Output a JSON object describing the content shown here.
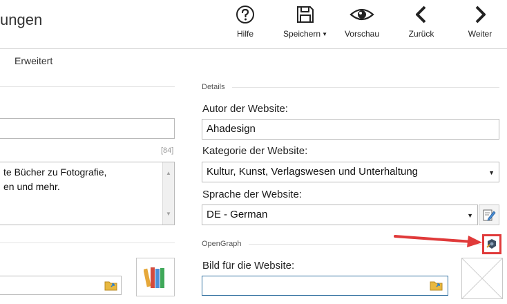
{
  "header": {
    "title": "ungen",
    "tools": [
      {
        "label": "Hilfe",
        "icon": "help-icon"
      },
      {
        "label": "Speichern",
        "icon": "save-icon",
        "dropdown": true
      },
      {
        "label": "Vorschau",
        "icon": "eye-icon"
      },
      {
        "label": "Zurück",
        "icon": "chevron-left-icon"
      },
      {
        "label": "Weiter",
        "icon": "chevron-right-icon"
      }
    ]
  },
  "tabs": {
    "erweitert": "Erweitert"
  },
  "left": {
    "counter": "[84]",
    "description_line1": "te Bücher zu Fotografie,",
    "description_line2": "en und mehr."
  },
  "details": {
    "section_label": "Details",
    "author_label": "Autor der Website:",
    "author_value": "Ahadesign",
    "category_label": "Kategorie der Website:",
    "category_value": "Kultur, Kunst, Verlagswesen und Unterhaltung",
    "language_label": "Sprache der Website:",
    "language_value": "DE - German"
  },
  "opengraph": {
    "section_label": "OpenGraph",
    "image_label": "Bild für die Website:",
    "image_value": ""
  },
  "colors": {
    "highlight": "#e03a3a",
    "focus_border": "#2f6f9f"
  }
}
